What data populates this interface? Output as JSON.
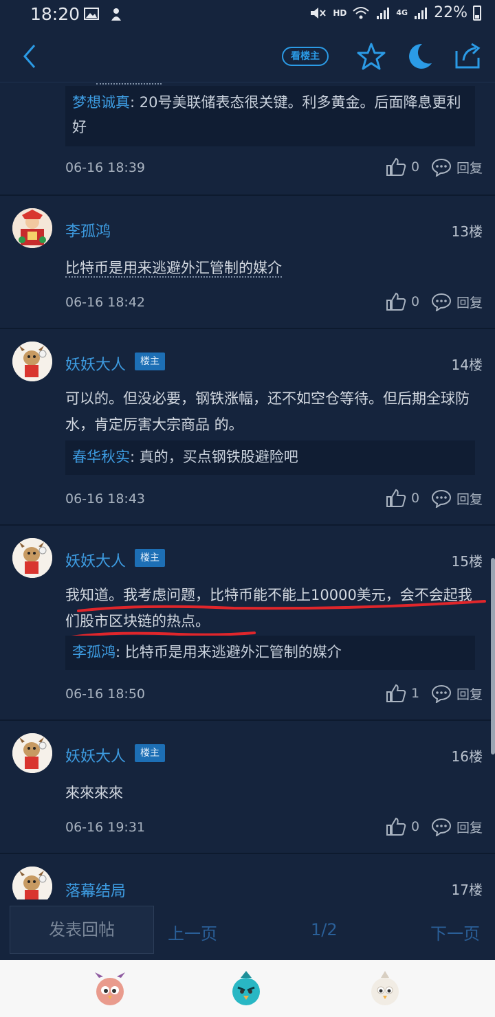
{
  "status": {
    "time": "18:20",
    "network": "HD",
    "signal_label": "4G",
    "battery": "22%"
  },
  "nav": {
    "owner_only_label": "看楼主"
  },
  "top_quote": {
    "name": "梦想诚真",
    "text": ": 20号美联储表态很关键。利多黄金。后面降息更利好",
    "time": "06-16 18:39",
    "likes": "0",
    "reply_label": "回复"
  },
  "posts": [
    {
      "username": "李孤鸿",
      "is_owner": false,
      "floor": "13楼",
      "text": "比特币是用来逃避外汇管制的媒介",
      "time": "06-16 18:42",
      "likes": "0",
      "reply_label": "回复"
    },
    {
      "username": "妖妖大人",
      "is_owner": true,
      "owner_badge": "楼主",
      "floor": "14楼",
      "text": "可以的。但没必要，钢铁涨幅，还不如空仓等待。但后期全球防水，肯定厉害大宗商品 的。",
      "quote_name": "春华秋实",
      "quote_text": ": 真的，买点钢铁股避险吧",
      "time": "06-16 18:43",
      "likes": "0",
      "reply_label": "回复"
    },
    {
      "username": "妖妖大人",
      "is_owner": true,
      "owner_badge": "楼主",
      "floor": "15楼",
      "text": "我知道。我考虑问题，比特币能不能上10000美元，会不会起我们股市区块链的热点。",
      "quote_name": "李孤鸿",
      "quote_text": ": 比特币是用来逃避外汇管制的媒介",
      "time": "06-16 18:50",
      "likes": "1",
      "reply_label": "回复"
    },
    {
      "username": "妖妖大人",
      "is_owner": true,
      "owner_badge": "楼主",
      "floor": "16楼",
      "text": "來來來來",
      "time": "06-16 19:31",
      "likes": "0",
      "reply_label": "回复"
    },
    {
      "username": "落幕结局",
      "is_owner": false,
      "floor": "17楼"
    }
  ],
  "bottom": {
    "reply_button": "发表回帖",
    "prev": "上一页",
    "page": "1/2",
    "next": "下一页"
  },
  "colors": {
    "background": "#15243d",
    "accent": "#2b9be6",
    "username": "#3d9be0",
    "annotation": "#e0262b"
  }
}
